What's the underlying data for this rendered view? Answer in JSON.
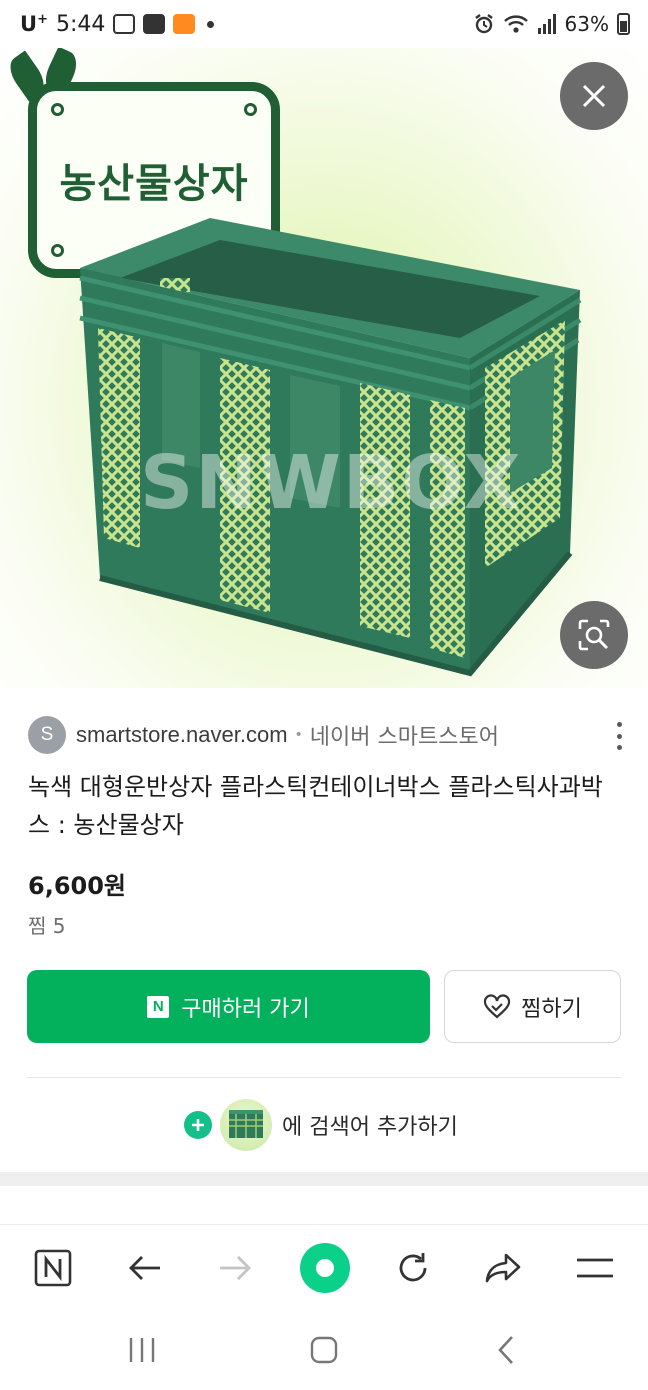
{
  "status_bar": {
    "carrier": "U",
    "carrier_sup": "+",
    "time": "5:44",
    "battery": "63%"
  },
  "hero": {
    "sign_text": "농산물상자",
    "watermark": "SNWBOX",
    "close_icon": "close-icon",
    "lens_icon": "lens-search-icon"
  },
  "result": {
    "favicon_letter": "S",
    "domain": "smartstore.naver.com",
    "separator": "•",
    "store_name": "네이버 스마트스토어",
    "title": "녹색 대형운반상자 플라스틱컨테이너박스 플라스틱사과박스 : 농산물상자",
    "price": "6,600원",
    "likes": "찜 5",
    "buy_badge": "N",
    "buy_label": "구매하러 가기",
    "save_label": "찜하기",
    "add_keyword_label": "에 검색어 추가하기"
  },
  "toolbar": {
    "items": [
      "naver-home-icon",
      "back-arrow-icon",
      "forward-arrow-icon",
      "green-dot-icon",
      "refresh-icon",
      "share-icon",
      "menu-icon"
    ]
  },
  "colors": {
    "accent_green": "#03b15c",
    "sign_green": "#1f5f33",
    "crate_green": "#2f7a5b",
    "add_green": "#14c08a"
  }
}
